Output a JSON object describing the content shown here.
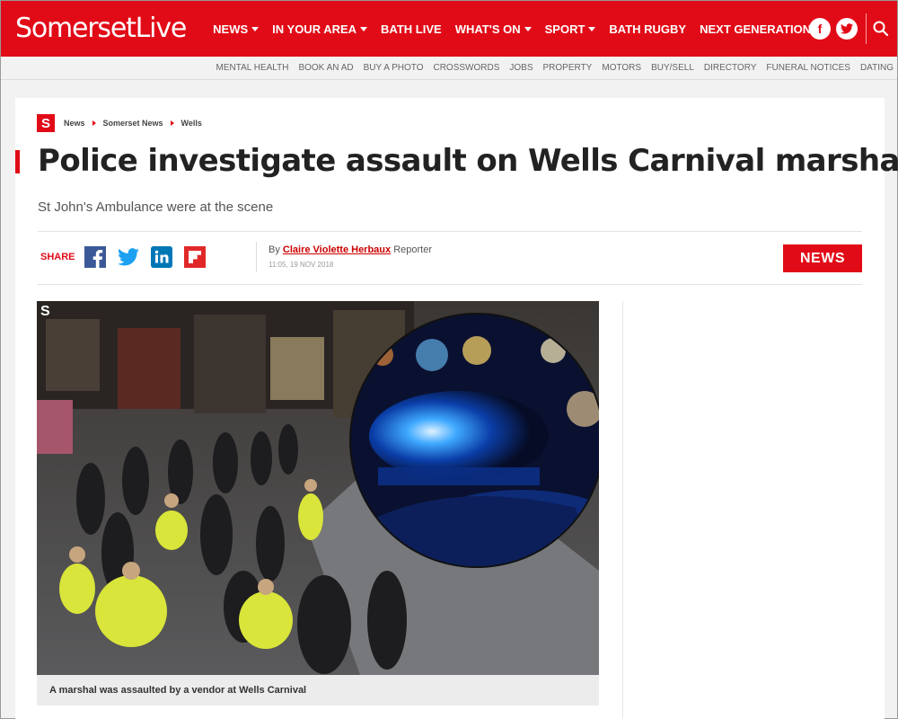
{
  "header": {
    "logo_bold": "Somerset",
    "logo_light": "Live",
    "nav": [
      {
        "label": "NEWS",
        "dropdown": true
      },
      {
        "label": "IN YOUR AREA",
        "dropdown": true
      },
      {
        "label": "BATH LIVE",
        "dropdown": false
      },
      {
        "label": "WHAT'S ON",
        "dropdown": true
      },
      {
        "label": "SPORT",
        "dropdown": true
      },
      {
        "label": "BATH RUGBY",
        "dropdown": false
      },
      {
        "label": "NEXT GENERATION",
        "dropdown": false
      }
    ],
    "social": [
      "f",
      "t"
    ],
    "accent_color": "#e10b17"
  },
  "subnav": [
    "MENTAL HEALTH",
    "BOOK AN AD",
    "BUY A PHOTO",
    "CROSSWORDS",
    "JOBS",
    "PROPERTY",
    "MOTORS",
    "BUY/SELL",
    "DIRECTORY",
    "FUNERAL NOTICES",
    "DATING"
  ],
  "article": {
    "crumb_logo": "S",
    "breadcrumb": [
      "News",
      "Somerset News",
      "Wells"
    ],
    "title": "Police investigate assault on Wells Carnival marshal",
    "subtitle": "St John's Ambulance were at the scene",
    "share_label": "SHARE",
    "share_icons": [
      "facebook-icon",
      "twitter-icon",
      "linkedin-icon",
      "flipboard-icon"
    ],
    "by": "By",
    "author": "Claire Violette Herbaux",
    "role": "Reporter",
    "date": "11:05, 19 NOV 2018",
    "badge": "NEWS",
    "image_caption": "A marshal was assaulted by a vendor at Wells Carnival",
    "photo_mark": "S"
  }
}
